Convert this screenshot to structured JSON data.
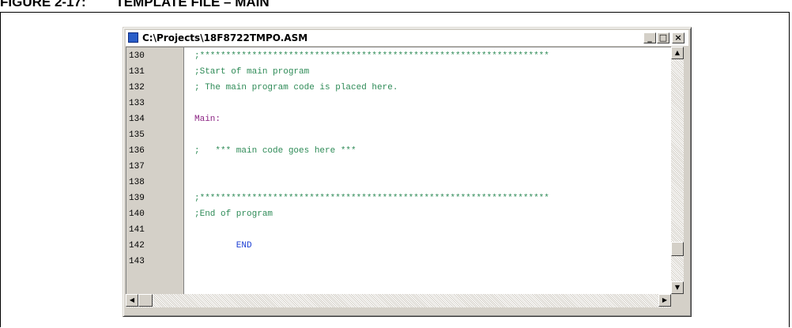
{
  "figure_caption": "FIGURE 2-17:        TEMPLATE FILE – MAIN",
  "window": {
    "title": "C:\\Projects\\18F8722TMPO.ASM",
    "minimize_glyph": "_",
    "maximize_glyph": "□",
    "close_glyph": "×"
  },
  "editor": {
    "lines": [
      {
        "num": "130",
        "text": ";*******************************************************************",
        "kind": "comment"
      },
      {
        "num": "131",
        "text": ";Start of main program",
        "kind": "comment"
      },
      {
        "num": "132",
        "text": "; The main program code is placed here.",
        "kind": "comment"
      },
      {
        "num": "133",
        "text": "",
        "kind": "comment"
      },
      {
        "num": "134",
        "text": "Main:",
        "kind": "label"
      },
      {
        "num": "135",
        "text": "",
        "kind": "comment"
      },
      {
        "num": "136",
        "text": ";   *** main code goes here ***",
        "kind": "comment"
      },
      {
        "num": "137",
        "text": "",
        "kind": "comment"
      },
      {
        "num": "138",
        "text": "",
        "kind": "comment"
      },
      {
        "num": "139",
        "text": ";*******************************************************************",
        "kind": "comment"
      },
      {
        "num": "140",
        "text": ";End of program",
        "kind": "comment"
      },
      {
        "num": "141",
        "text": "",
        "kind": "comment"
      },
      {
        "num": "142",
        "text": "        END",
        "kind": "keyword"
      },
      {
        "num": "143",
        "text": "",
        "kind": "comment"
      }
    ]
  },
  "scrollbars": {
    "vertical": {
      "up_glyph": "▲",
      "down_glyph": "▼",
      "thumb_position": 0.88
    },
    "horizontal": {
      "left_glyph": "◀",
      "right_glyph": "▶",
      "thumb_position": 0.0
    }
  },
  "colors": {
    "comment": "#2e8b57",
    "label": "#8b2283",
    "keyword": "#1c3fd4",
    "window_face": "#d4d0c8"
  }
}
